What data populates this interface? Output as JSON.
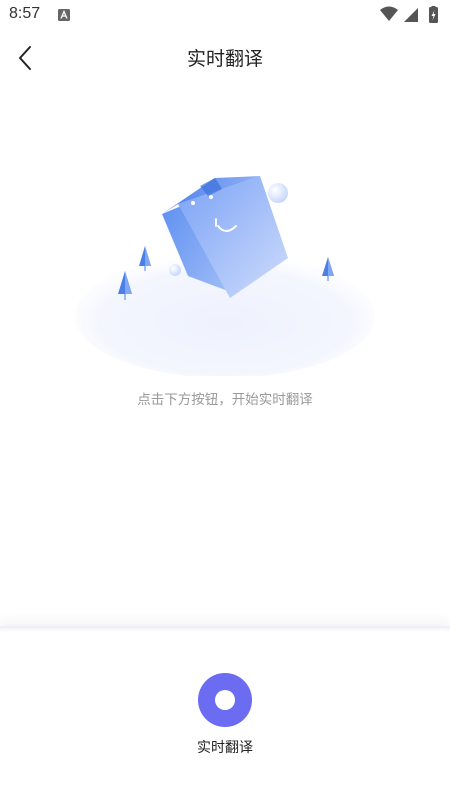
{
  "status_bar": {
    "time": "8:57",
    "icons": [
      "a-notification-icon",
      "wifi-icon",
      "signal-icon",
      "battery-icon"
    ]
  },
  "header": {
    "back_icon": "back-arrow-icon",
    "title": "实时翻译"
  },
  "main": {
    "illustration": "empty-state-bag-illustration",
    "hint": "点击下方按钮，开始实时翻译"
  },
  "bottom": {
    "record_button_icon": "record-icon",
    "label": "实时翻译"
  },
  "colors": {
    "accent": "#6b6cf2",
    "illustration_blue": "#5b8ef0",
    "hint_text": "#999999",
    "title_text": "#222222"
  }
}
